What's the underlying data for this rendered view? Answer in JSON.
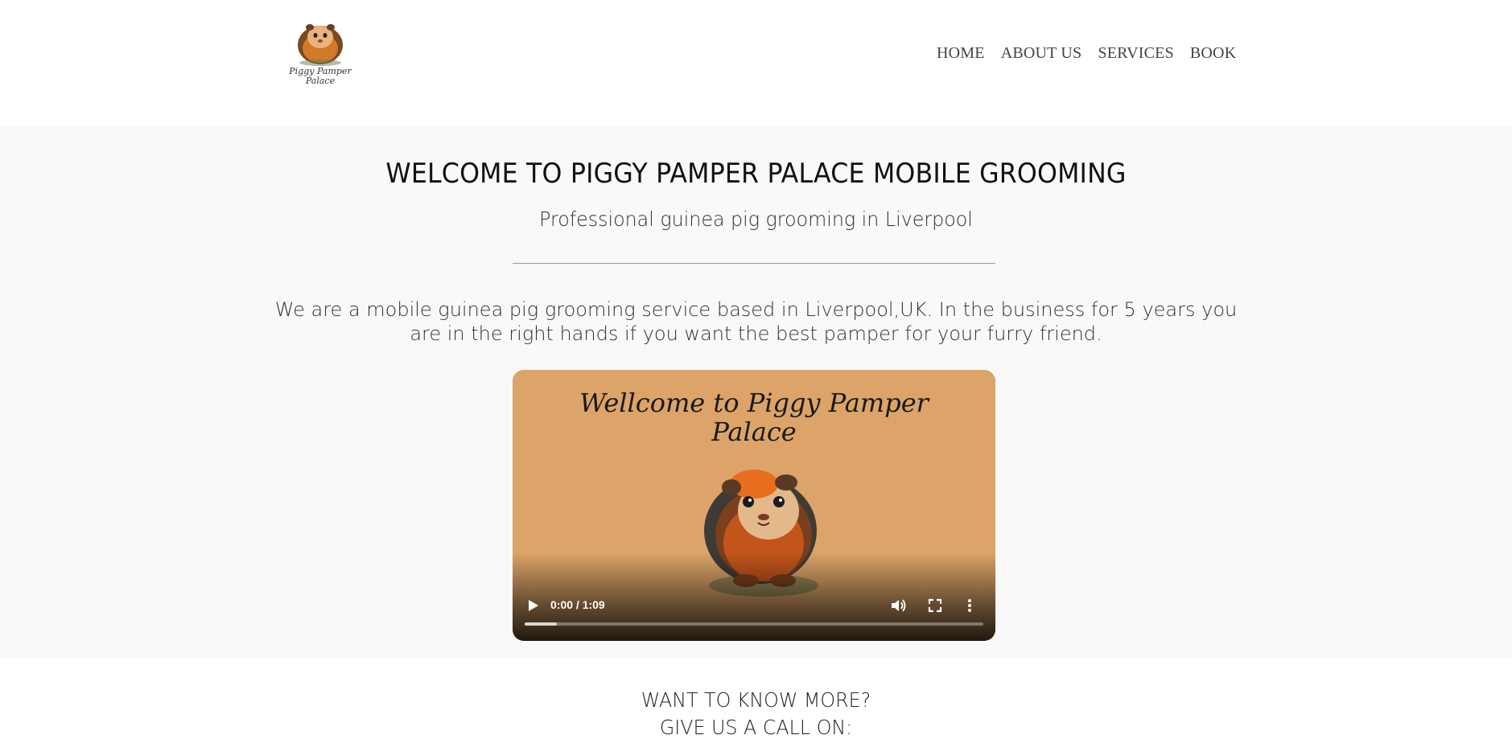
{
  "header": {
    "logo_text_line1": "Piggy Pamper",
    "logo_text_line2": "Palace",
    "nav": [
      {
        "label": "HOME"
      },
      {
        "label": "ABOUT US"
      },
      {
        "label": "SERVICES"
      },
      {
        "label": "BOOK"
      }
    ]
  },
  "hero": {
    "title": "WELCOME TO PIGGY PAMPER PALACE MOBILE GROOMING",
    "subtitle": "Professional guinea pig grooming in Liverpool",
    "body": "We are a mobile guinea pig grooming service based in Liverpool,UK. In the business for 5 years you are in the right hands if you want the best pamper for your furry friend."
  },
  "video": {
    "overlay_title_line1": "Wellcome to Piggy Pamper",
    "overlay_title_line2": "Palace",
    "time": "0:00 / 1:09",
    "buffered_fraction": 0.07,
    "icons": {
      "play": "play-icon",
      "volume": "volume-icon",
      "fullscreen": "fullscreen-icon",
      "more": "more-vert-icon"
    }
  },
  "more": {
    "line1": "WANT TO KNOW MORE?",
    "line2": "GIVE US A CALL ON:"
  },
  "colors": {
    "hero_bg": "#f9f9f9",
    "video_bg": "#dca468",
    "nav_text": "#444444"
  }
}
